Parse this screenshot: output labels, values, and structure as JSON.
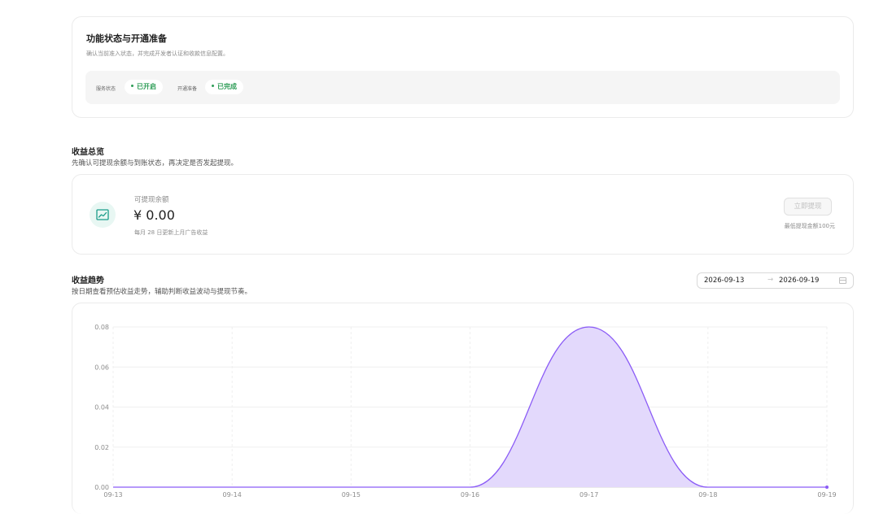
{
  "status_card": {
    "title": "功能状态与开通准备",
    "description": "确认当前准入状态，并完成开发者认证和收款信息配置。",
    "service_status_label": "服务状态",
    "service_status_value": "已开启",
    "setup_label": "开通准备",
    "setup_value": "已完成"
  },
  "overview": {
    "title": "收益总览",
    "description": "先确认可提现余额与到账状态，再决定是否发起提现。",
    "balance_label": "可提现余额",
    "balance_amount": "¥ 0.00",
    "balance_note": "每月 28 日更新上月广告收益",
    "withdraw_button": "立即提现",
    "withdraw_note": "最低提现金额100元"
  },
  "trend": {
    "title": "收益趋势",
    "description": "按日期查看预估收益走势，辅助判断收益波动与提现节奏。",
    "date_start": "2026-09-13",
    "date_separator": "→",
    "date_end": "2026-09-19"
  },
  "colors": {
    "accent": "#8b5cf6",
    "area_fill": "#e3d9fc",
    "success": "#2e9d57",
    "icon_teal": "#1a9c8a"
  },
  "chart_data": {
    "type": "area",
    "categories": [
      "09-13",
      "09-14",
      "09-15",
      "09-16",
      "09-17",
      "09-18",
      "09-19"
    ],
    "values": [
      0,
      0,
      0,
      0,
      0.08,
      0,
      0
    ],
    "title": "",
    "xlabel": "",
    "ylabel": "",
    "ylim": [
      0,
      0.08
    ],
    "yticks": [
      "0.08",
      "0.06",
      "0.04",
      "0.02",
      "0.00"
    ],
    "smooth": true,
    "grid": true
  }
}
